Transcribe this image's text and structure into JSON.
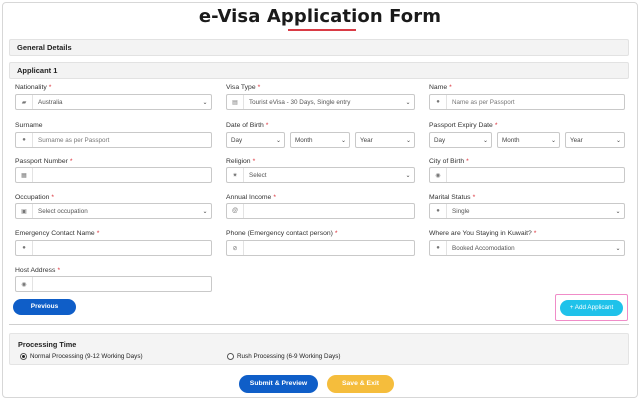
{
  "page": {
    "title": "e-Visa Application Form"
  },
  "sections": {
    "general": "General Details",
    "applicant": "Applicant 1"
  },
  "fields": {
    "nationality": {
      "label": "Nationality",
      "value": "Australia"
    },
    "visa_type": {
      "label": "Visa Type",
      "value": "Tourist eVisa - 30 Days, Single entry"
    },
    "name": {
      "label": "Name",
      "placeholder": "Name as per Passport"
    },
    "surname": {
      "label": "Surname",
      "placeholder": "Surname as per Passport"
    },
    "dob": {
      "label": "Date of Birth",
      "day": "Day",
      "month": "Month",
      "year": "Year"
    },
    "passport_expiry": {
      "label": "Passport Expiry Date",
      "day": "Day",
      "month": "Month",
      "year": "Year"
    },
    "passport_number": {
      "label": "Passport Number"
    },
    "religion": {
      "label": "Religion",
      "value": "Select"
    },
    "city_of_birth": {
      "label": "City of Birth"
    },
    "occupation": {
      "label": "Occupation",
      "value": "Select occupation"
    },
    "annual_income": {
      "label": "Annual Income"
    },
    "marital_status": {
      "label": "Marital Status",
      "value": "Single"
    },
    "emergency_name": {
      "label": "Emergency Contact Name"
    },
    "emergency_phone": {
      "label": "Phone (Emergency contact person)"
    },
    "staying": {
      "label": "Where are You Staying in Kuwait?",
      "value": "Booked Accomodation"
    },
    "host_address": {
      "label": "Host Address"
    }
  },
  "required_marker": "*",
  "buttons": {
    "previous": "Previous",
    "add_applicant": "+ Add Applicant",
    "submit": "Submit & Preview",
    "save_exit": "Save & Exit"
  },
  "processing": {
    "title": "Processing Time",
    "options": [
      {
        "label": "Normal Processing (9-12 Working Days)",
        "selected": true
      },
      {
        "label": "Rush Processing (6-9 Working Days)",
        "selected": false
      }
    ]
  },
  "colors": {
    "primary": "#0f5ec8",
    "accent": "#1fc2ea",
    "save": "#f5bd3c",
    "required": "#d9262f",
    "highlight": "#f08cc8"
  }
}
